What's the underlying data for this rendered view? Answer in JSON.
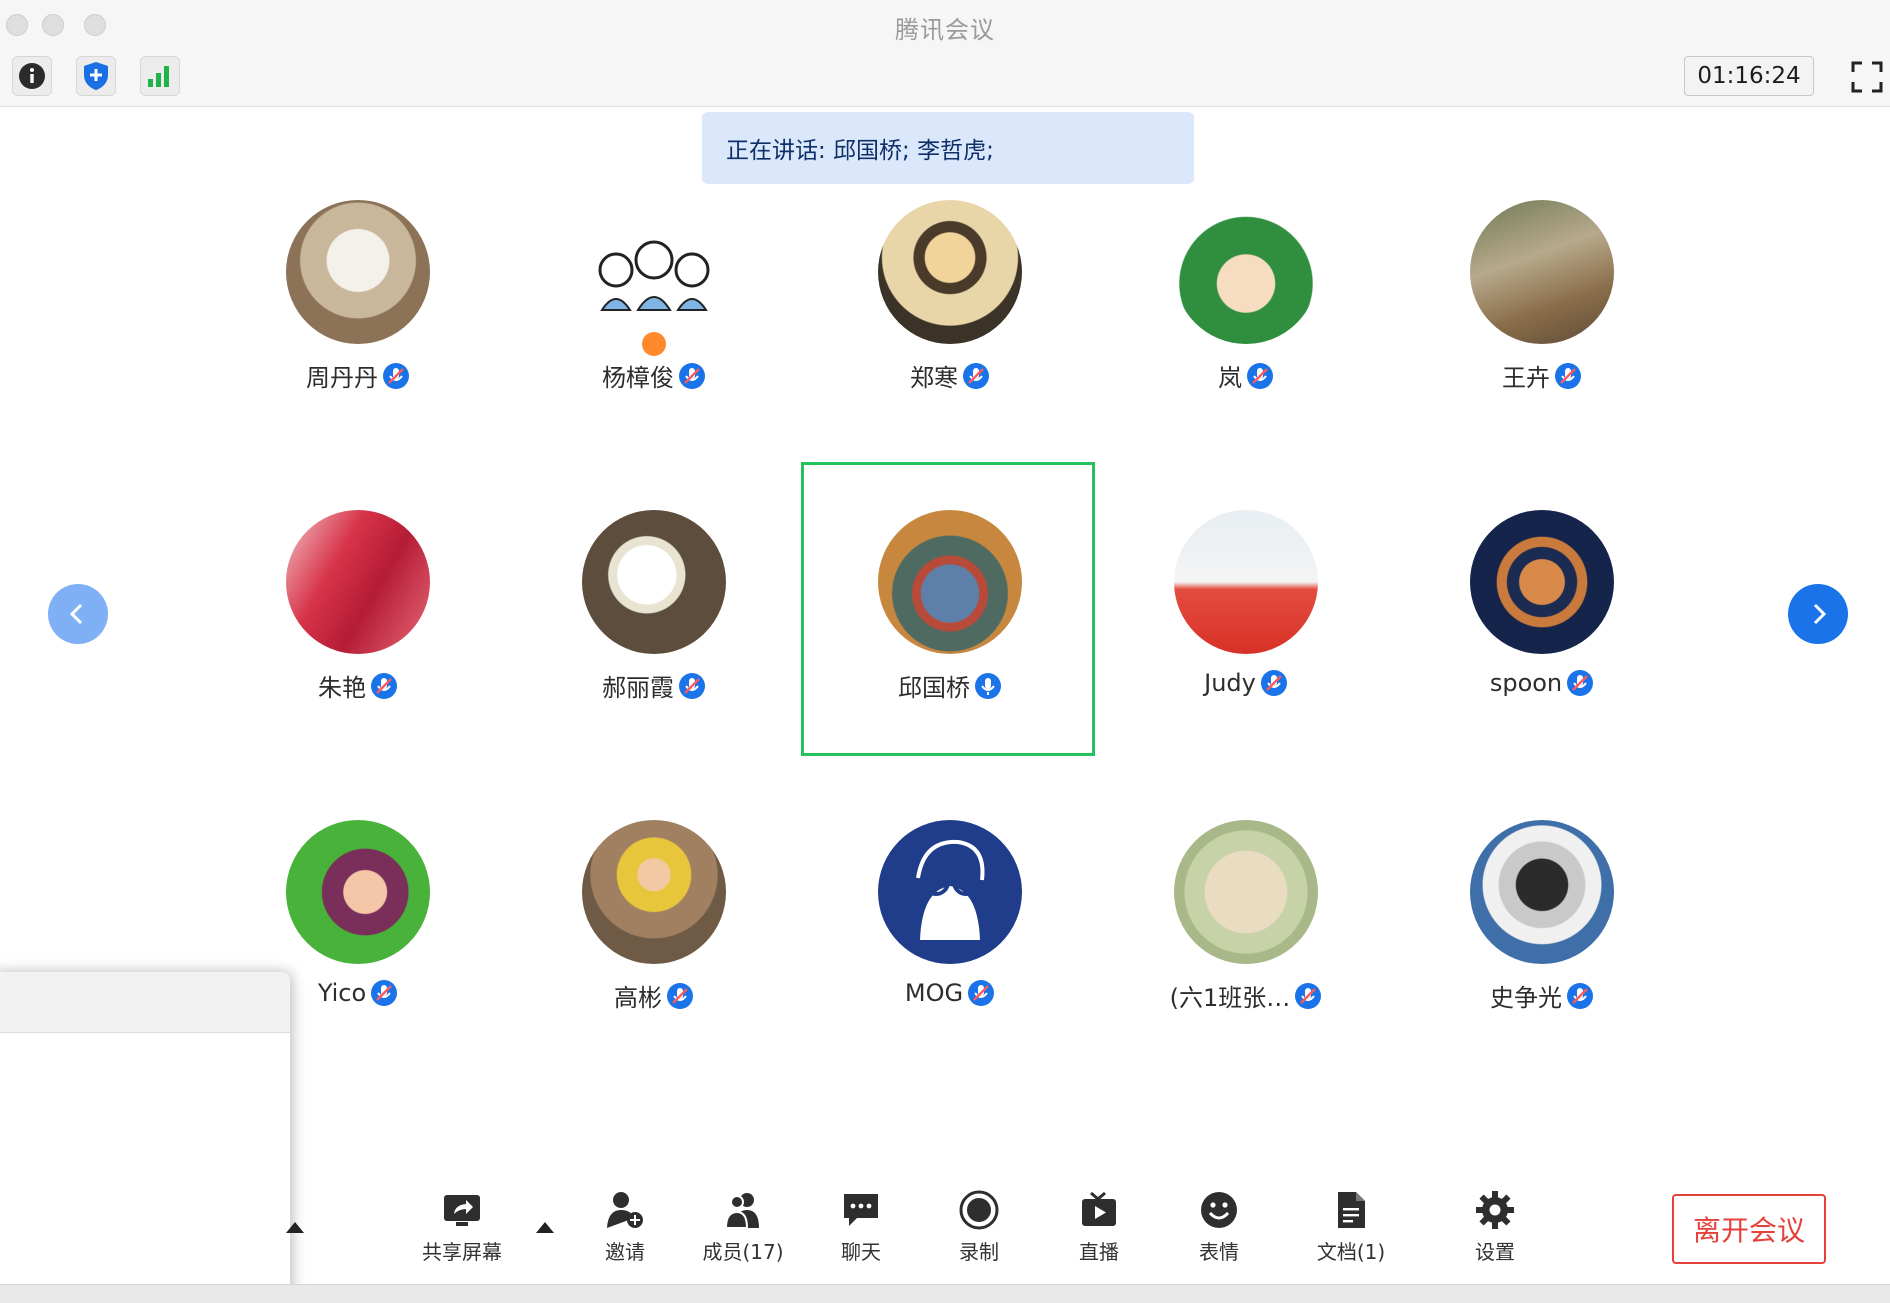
{
  "window": {
    "title": "腾讯会议"
  },
  "toolbar": {
    "info_icon": "info-icon",
    "security_icon": "shield-icon",
    "signal_icon": "signal-bars-icon",
    "timer": "01:16:24",
    "fullscreen_icon": "fullscreen-icon"
  },
  "speaking": {
    "text": "正在讲话: 邱国桥; 李哲虎;"
  },
  "participants": [
    {
      "name": "周丹丹",
      "mic": "muted"
    },
    {
      "name": "杨樟俊",
      "mic": "muted",
      "host": true
    },
    {
      "name": "郑寒",
      "mic": "muted"
    },
    {
      "name": "岚",
      "mic": "muted"
    },
    {
      "name": "王卉",
      "mic": "muted"
    },
    {
      "name": "朱艳",
      "mic": "muted"
    },
    {
      "name": "郝丽霞",
      "mic": "muted"
    },
    {
      "name": "邱国桥",
      "mic": "on",
      "speaking": true
    },
    {
      "name": "Judy",
      "mic": "muted"
    },
    {
      "name": "spoon",
      "mic": "muted"
    },
    {
      "name": "Yico",
      "mic": "muted"
    },
    {
      "name": "高彬",
      "mic": "muted"
    },
    {
      "name": "MOG",
      "mic": "muted"
    },
    {
      "name": "(六1班张…",
      "mic": "muted"
    },
    {
      "name": "史争光",
      "mic": "muted"
    }
  ],
  "controls": {
    "share_screen": "共享屏幕",
    "invite": "邀请",
    "members": "成员(17)",
    "chat": "聊天",
    "record": "录制",
    "live": "直播",
    "reactions": "表情",
    "docs": "文档(1)",
    "settings": "设置",
    "leave": "离开会议"
  },
  "colors": {
    "accent": "#1a73e8",
    "speaking_bg": "#dbe8fb",
    "active_border": "#22c35d",
    "leave_red": "#e5403b"
  }
}
